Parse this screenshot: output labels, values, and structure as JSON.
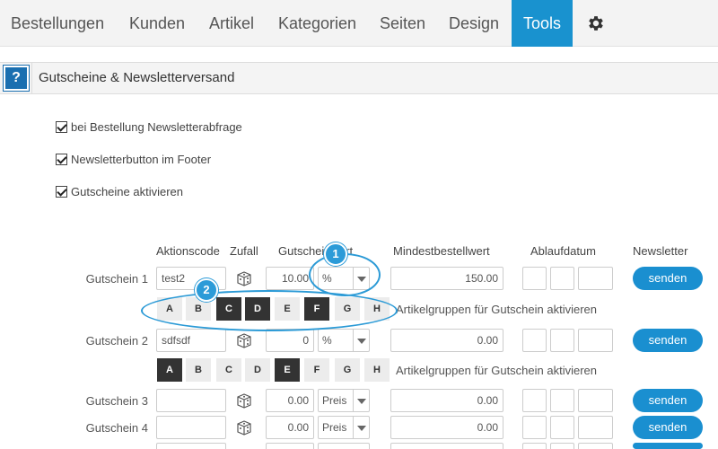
{
  "nav": {
    "items": [
      "Bestellungen",
      "Kunden",
      "Artikel",
      "Kategorien",
      "Seiten",
      "Design",
      "Tools"
    ],
    "active": "Tools",
    "settings_icon": "gear-icon"
  },
  "section": {
    "help_label": "?",
    "title": "Gutscheine & Newsletterversand"
  },
  "checkboxes": [
    {
      "label": "bei Bestellung Newsletterabfrage",
      "checked": true
    },
    {
      "label": "Newsletterbutton im Footer",
      "checked": true
    },
    {
      "label": "Gutscheine aktivieren",
      "checked": true
    }
  ],
  "table": {
    "headers": {
      "code": "Aktionscode",
      "random": "Zufall",
      "value": "Gutscheinwert",
      "min_order": "Mindestbestellwert",
      "expiry": "Ablaufdatum",
      "newsletter": "Newsletter"
    },
    "rows": [
      {
        "label": "Gutschein 1",
        "code": "test2",
        "value": "10.00",
        "unit": "%",
        "min_order": "150.00",
        "send": "senden",
        "letters": [
          "A",
          "B",
          "C",
          "D",
          "E",
          "F",
          "G",
          "H"
        ],
        "letters_active": [
          false,
          false,
          true,
          true,
          false,
          true,
          false,
          false
        ],
        "groups_label": "Artikelgruppen für Gutschein aktivieren"
      },
      {
        "label": "Gutschein 2",
        "code": "sdfsdf",
        "value": "0",
        "unit": "%",
        "min_order": "0.00",
        "send": "senden",
        "letters": [
          "A",
          "B",
          "C",
          "D",
          "E",
          "F",
          "G",
          "H"
        ],
        "letters_active": [
          true,
          false,
          false,
          false,
          true,
          false,
          false,
          false
        ],
        "groups_label": "Artikelgruppen für Gutschein aktivieren"
      },
      {
        "label": "Gutschein 3",
        "code": "",
        "value": "0.00",
        "unit": "Preis",
        "min_order": "0.00",
        "send": "senden"
      },
      {
        "label": "Gutschein 4",
        "code": "",
        "value": "0.00",
        "unit": "Preis",
        "min_order": "0.00",
        "send": "senden"
      }
    ]
  },
  "callouts": [
    "1",
    "2"
  ],
  "colors": {
    "accent": "#1a8fd0",
    "active_nav": "#1992cf",
    "dark_letter": "#333333"
  }
}
